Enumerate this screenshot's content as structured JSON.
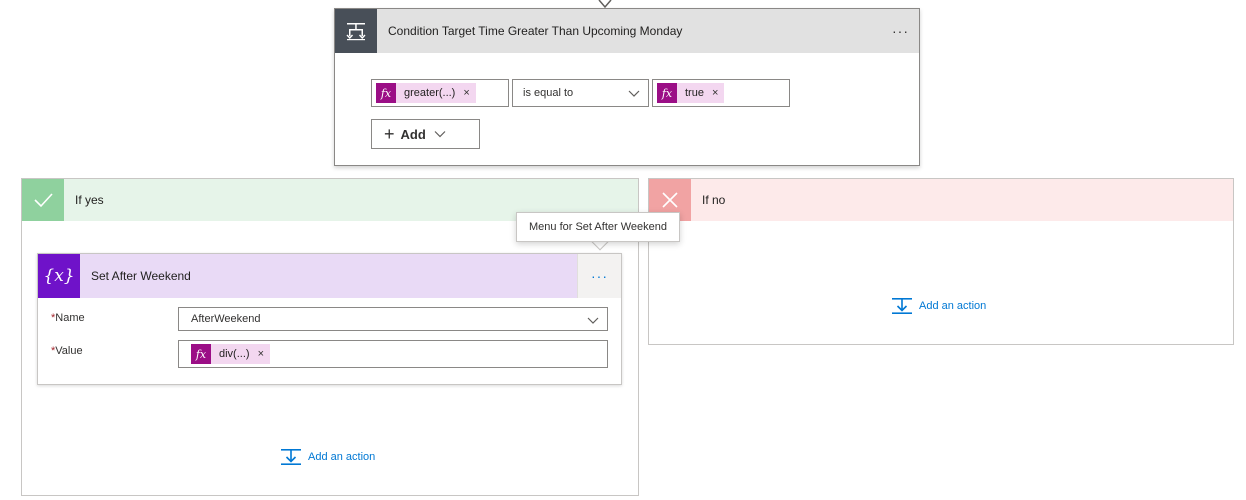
{
  "condition": {
    "title": "Condition Target Time Greater Than Upcoming Monday",
    "menu_label": "···",
    "left_operand": {
      "text": "greater(...)",
      "remove": "×"
    },
    "operator": {
      "selected": "is equal to"
    },
    "right_operand": {
      "text": "true",
      "remove": "×"
    },
    "add_label": "Add",
    "add_plus": "+"
  },
  "fx_label": "fx",
  "yes_branch": {
    "title": "If yes",
    "add_action_label": "Add an action"
  },
  "no_branch": {
    "title": "If no",
    "add_action_label": "Add an action"
  },
  "set_variable": {
    "icon_text": "{x}",
    "title": "Set After Weekend",
    "menu_label": "···",
    "name_label": "Name",
    "name_value": "AfterWeekend",
    "value_label": "Value",
    "value_token": {
      "text": "div(...)",
      "remove": "×"
    },
    "required_mark": "*"
  },
  "tooltip": {
    "text": "Menu for Set After Weekend"
  },
  "colors": {
    "condition_icon_bg": "#484f58",
    "yes_accent": "#8fd19e",
    "no_accent": "#f1a3a3",
    "variable_accent": "#6f12c9",
    "expression_token": "#9b0e86",
    "link_blue": "#0078d4"
  },
  "icons": {
    "condition": "condition-icon",
    "yes": "check-icon",
    "no": "close-icon",
    "variable": "variable-icon",
    "add_action": "add-action-icon"
  }
}
